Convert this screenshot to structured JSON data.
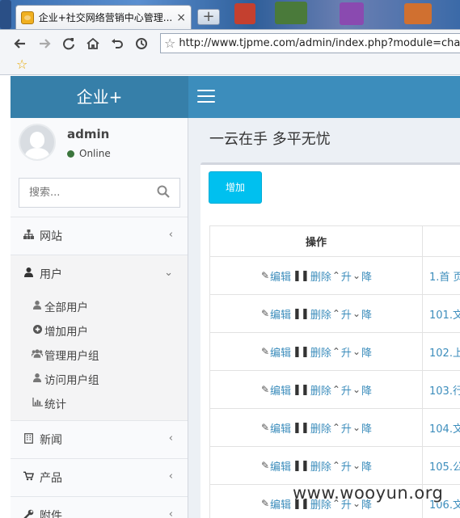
{
  "browser": {
    "tab_title": "企业+社交网络营销中心管理...",
    "tab_close": "×",
    "new_tab": "+",
    "url": "http://www.tjpme.com/admin/index.php?module=channel",
    "bookmark_icon": "star-icon"
  },
  "header": {
    "brand": "企业+",
    "menu_toggle_icon": "hamburger-icon",
    "accent_color": "#3c8dbc"
  },
  "user": {
    "name": "admin",
    "status": "Online"
  },
  "search": {
    "placeholder": "搜索..."
  },
  "sidebar": {
    "items": [
      {
        "label": "网站",
        "icon": "sitemap-icon"
      },
      {
        "label": "用户",
        "icon": "user-icon",
        "expanded": true,
        "children": [
          {
            "label": "全部用户",
            "icon": "user-icon"
          },
          {
            "label": "增加用户",
            "icon": "plus-circle-icon"
          },
          {
            "label": "管理用户组",
            "icon": "users-icon"
          },
          {
            "label": "访问用户组",
            "icon": "user-icon"
          },
          {
            "label": "统计",
            "icon": "bar-chart-icon"
          }
        ]
      },
      {
        "label": "新闻",
        "icon": "building-icon"
      },
      {
        "label": "产品",
        "icon": "cart-icon"
      },
      {
        "label": "附件",
        "icon": "wrench-icon"
      }
    ]
  },
  "content": {
    "title": "一云在手 多平无忧",
    "add_button": "增加",
    "table": {
      "headers": [
        "操作",
        ""
      ],
      "actions": {
        "edit": "编辑",
        "delete": "删除",
        "up": "升",
        "down": "降"
      },
      "rows": [
        {
          "name": "1.首 页"
        },
        {
          "name": "101.文"
        },
        {
          "name": "102.上"
        },
        {
          "name": "103.行"
        },
        {
          "name": "104.文"
        },
        {
          "name": "105.公"
        },
        {
          "name": "106.文"
        }
      ]
    }
  },
  "watermark": "www.wooyun.org"
}
